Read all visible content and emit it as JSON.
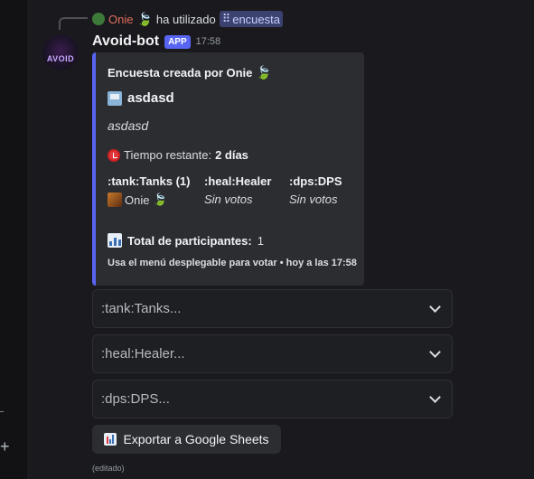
{
  "reference": {
    "user": "Onie",
    "action": "ha utilizado",
    "command": "encuesta",
    "command_glyph": "⠿"
  },
  "message": {
    "author": "Avoid-bot",
    "badge": "APP",
    "time": "17:58",
    "avatar_text": "AVOID",
    "edited": "(editado)"
  },
  "embed": {
    "accent_color": "#5865f2",
    "author": "Encuesta creada por Onie",
    "title": "asdasd",
    "description": "asdasd",
    "time_label": "Tiempo restante:",
    "time_value": "2 días",
    "fields": [
      {
        "name": ":tank:Tanks (1)",
        "value": "Onie"
      },
      {
        "name": ":heal:Healer",
        "value": "Sin votos"
      },
      {
        "name": ":dps:DPS",
        "value": "Sin votos"
      }
    ],
    "participants_label": "Total de participantes:",
    "participants_value": "1",
    "footer": "Usa el menú desplegable para votar • hoy a las 17:58"
  },
  "selects": [
    {
      "placeholder": ":tank:Tanks..."
    },
    {
      "placeholder": ":heal:Healer..."
    },
    {
      "placeholder": ":dps:DPS..."
    }
  ],
  "export_button": {
    "label": "Exportar a Google Sheets"
  },
  "icons": {
    "leaf": "leaf-icon",
    "alarm": "alarm-clock-icon",
    "chart": "bar-chart-icon",
    "poll": "ballot-box-icon",
    "chevron": "chevron-down-icon"
  },
  "colors": {
    "background": "#1a1a1e",
    "embed_background": "#2b2d31",
    "app_badge": "#5865f2",
    "username_red": "#e06c5a"
  }
}
